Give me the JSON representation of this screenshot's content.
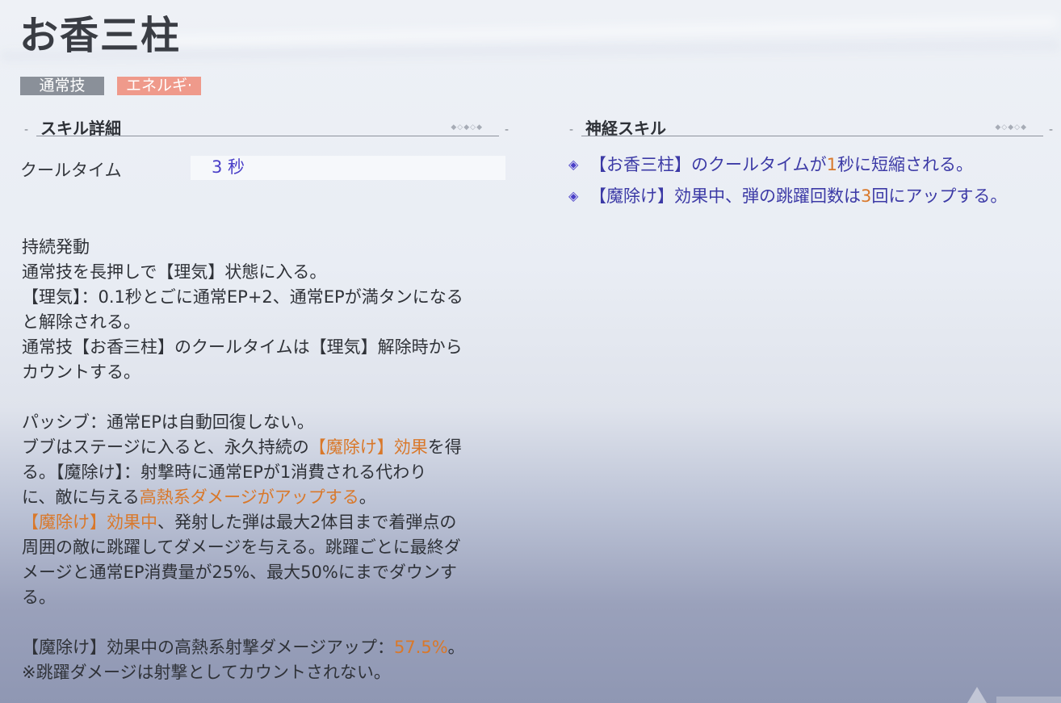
{
  "skill_name": "お香三柱",
  "tags": {
    "type": "通常技",
    "resource": "エネルギ·"
  },
  "details_section": {
    "title": "スキル詳細",
    "cooldown_label": "クールタイム",
    "cooldown_value": "3 秒"
  },
  "description": {
    "lines": [
      [
        "持続発動"
      ],
      [
        "通常技を長押しで【理気】状態に入る。"
      ],
      [
        "【理気】：0.1秒とごに通常EP+2、通常EPが満タンになる"
      ],
      [
        "と解除される。"
      ],
      [
        "通常技【お香三柱】のクールタイムは【理気】解除時から"
      ],
      [
        "カウントする。"
      ],
      [
        "パッシブ：通常EPは自動回復しない。"
      ],
      [
        "ブブはステージに入ると、永久持続の",
        "【魔除け】効果",
        "を得"
      ],
      [
        "る。【魔除け】：射撃時に通常EPが1消費される代わり"
      ],
      [
        "に、敵に与える",
        "高熱系ダメージがアップする",
        "。"
      ],
      [
        "【魔除け】効果中",
        "、発射した弾は最大2体目まで着弾点の"
      ],
      [
        "周囲の敵に跳躍してダメージを与える。跳躍ごとに最終ダ"
      ],
      [
        "メージと通常EP消費量が25%、最大50%にまでダウンす"
      ],
      [
        "る。"
      ],
      [
        "【魔除け】効果中の高熱系射撃ダメージアップ：",
        "57.5%",
        "。"
      ],
      [
        "※跳躍ダメージは射撃としてカウントされない。"
      ]
    ]
  },
  "neural_section": {
    "title": "神経スキル",
    "items": [
      {
        "pre": "【お香三柱】のクールタイムが",
        "num": "1",
        "post": "秒に短縮される。"
      },
      {
        "pre": "【魔除け】効果中、弾の跳躍回数は",
        "num": "3",
        "post": "回にアップする。"
      }
    ]
  },
  "colors": {
    "accent_orange": "#d9782a",
    "value_purple": "#4a3fc8",
    "tag_gray": "#8a9099",
    "tag_salmon": "#ef9a8b"
  },
  "icons": {
    "bullet": "diamond-icon"
  }
}
